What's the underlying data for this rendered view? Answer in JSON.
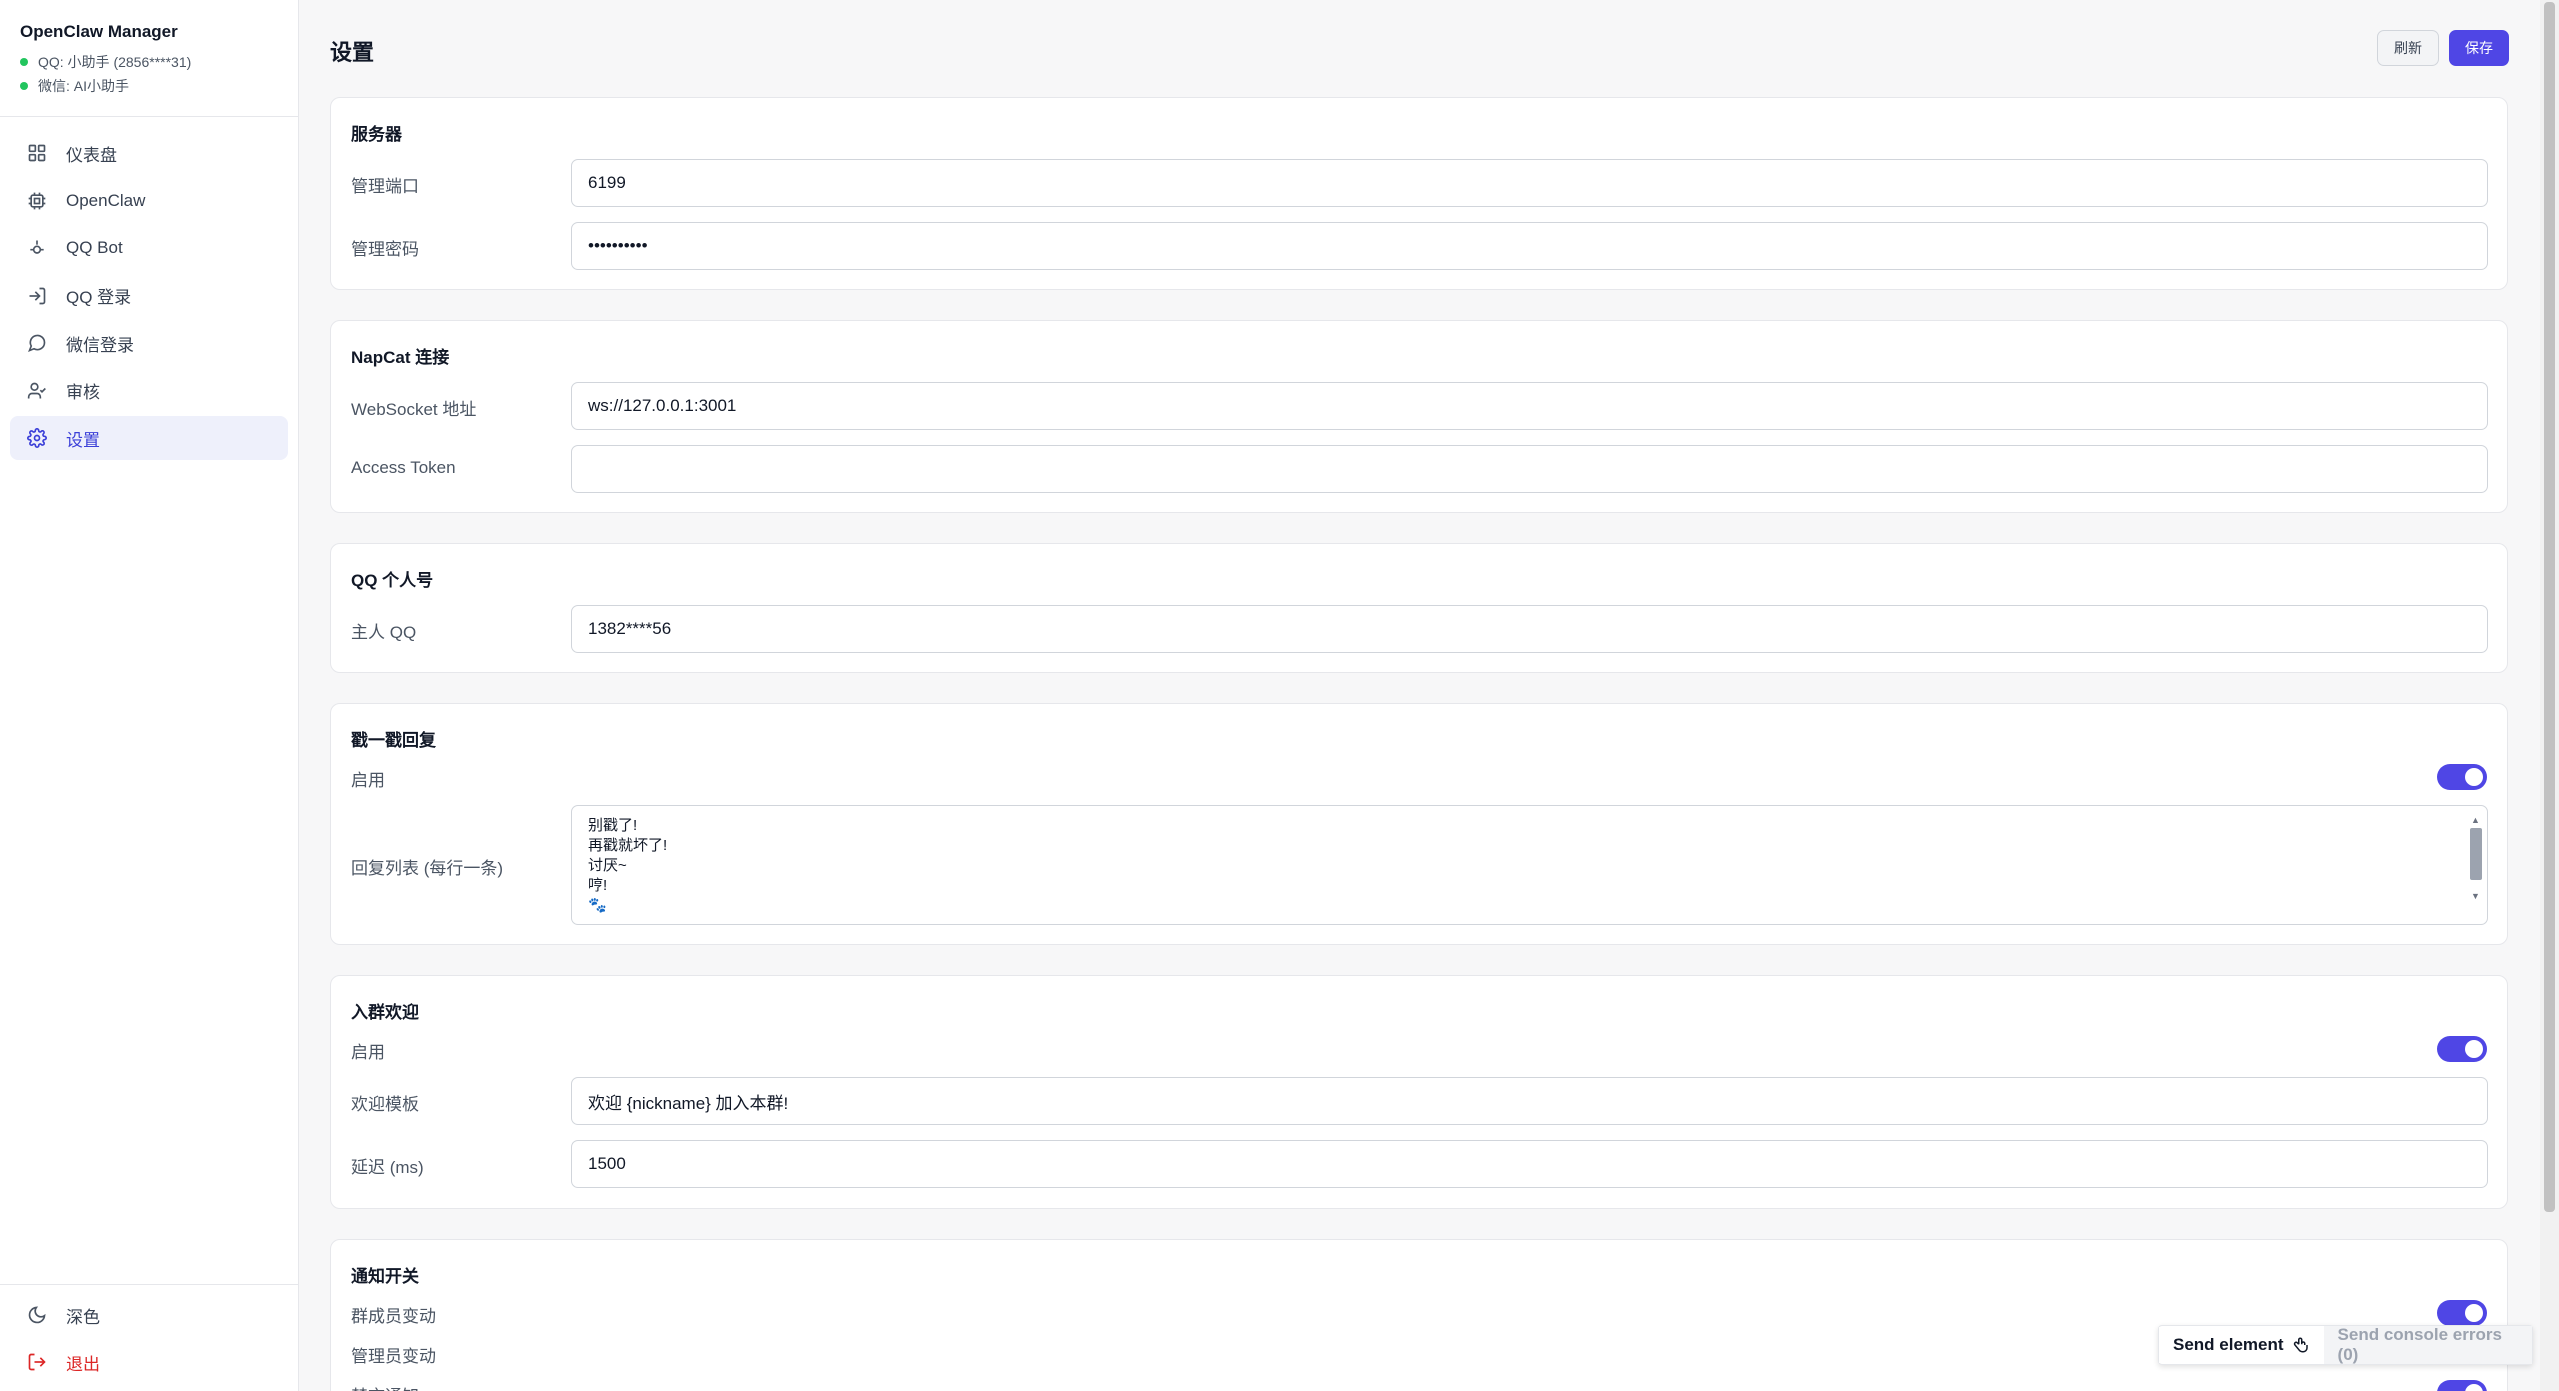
{
  "app": {
    "title": "OpenClaw Manager",
    "status": [
      {
        "text": "QQ: 小助手 (2856****31)",
        "color": "#22c55e"
      },
      {
        "text": "微信: AI小助手",
        "color": "#22c55e"
      }
    ]
  },
  "nav": {
    "items": [
      {
        "label": "仪表盘",
        "icon": "grid-icon"
      },
      {
        "label": "OpenClaw",
        "icon": "cpu-icon"
      },
      {
        "label": "QQ Bot",
        "icon": "bot-icon"
      },
      {
        "label": "QQ 登录",
        "icon": "login-icon"
      },
      {
        "label": "微信登录",
        "icon": "chat-icon"
      },
      {
        "label": "审核",
        "icon": "user-check-icon"
      },
      {
        "label": "设置",
        "icon": "gear-icon",
        "active": true
      }
    ],
    "theme_label": "深色",
    "logout_label": "退出"
  },
  "header": {
    "title": "设置",
    "refresh_label": "刷新",
    "save_label": "保存"
  },
  "sections": {
    "server": {
      "title": "服务器",
      "port_label": "管理端口",
      "port_value": "6199",
      "password_label": "管理密码",
      "password_value": "••••••••••"
    },
    "napcat": {
      "title": "NapCat 连接",
      "ws_label": "WebSocket 地址",
      "ws_value": "ws://127.0.0.1:3001",
      "token_label": "Access Token",
      "token_value": ""
    },
    "qq_personal": {
      "title": "QQ 个人号",
      "owner_label": "主人 QQ",
      "owner_value": "1382****56"
    },
    "poke": {
      "title": "戳一戳回复",
      "enable_label": "启用",
      "enabled": true,
      "list_label": "回复列表 (每行一条)",
      "list_lines": [
        "别戳了!",
        "再戳就坏了!",
        "讨厌~",
        "哼!",
        "🐾"
      ]
    },
    "welcome": {
      "title": "入群欢迎",
      "enable_label": "启用",
      "enabled": true,
      "template_label": "欢迎模板",
      "template_value": "欢迎 {nickname} 加入本群!",
      "delay_label": "延迟 (ms)",
      "delay_value": "1500"
    },
    "notify": {
      "title": "通知开关",
      "member_change_label": "群成员变动",
      "member_change_enabled": true,
      "admin_change_label": "管理员变动",
      "third_label": "禁言通知"
    }
  },
  "devtools": {
    "send_element_label": "Send element",
    "send_errors_label": "Send console errors (0)"
  },
  "colors": {
    "accent": "#4f46e5",
    "active_bg": "#eef0fb",
    "online": "#22c55e",
    "danger": "#dc2626"
  }
}
